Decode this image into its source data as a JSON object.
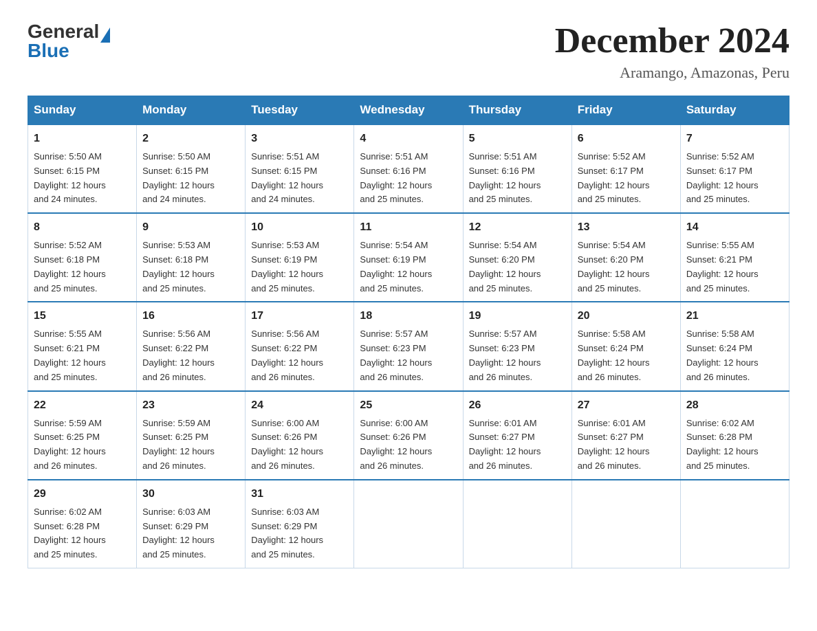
{
  "logo": {
    "general": "General",
    "triangle": "▶",
    "blue": "Blue"
  },
  "title": "December 2024",
  "subtitle": "Aramango, Amazonas, Peru",
  "days_of_week": [
    "Sunday",
    "Monday",
    "Tuesday",
    "Wednesday",
    "Thursday",
    "Friday",
    "Saturday"
  ],
  "weeks": [
    [
      {
        "day": "1",
        "sunrise": "5:50 AM",
        "sunset": "6:15 PM",
        "daylight": "12 hours and 24 minutes."
      },
      {
        "day": "2",
        "sunrise": "5:50 AM",
        "sunset": "6:15 PM",
        "daylight": "12 hours and 24 minutes."
      },
      {
        "day": "3",
        "sunrise": "5:51 AM",
        "sunset": "6:15 PM",
        "daylight": "12 hours and 24 minutes."
      },
      {
        "day": "4",
        "sunrise": "5:51 AM",
        "sunset": "6:16 PM",
        "daylight": "12 hours and 25 minutes."
      },
      {
        "day": "5",
        "sunrise": "5:51 AM",
        "sunset": "6:16 PM",
        "daylight": "12 hours and 25 minutes."
      },
      {
        "day": "6",
        "sunrise": "5:52 AM",
        "sunset": "6:17 PM",
        "daylight": "12 hours and 25 minutes."
      },
      {
        "day": "7",
        "sunrise": "5:52 AM",
        "sunset": "6:17 PM",
        "daylight": "12 hours and 25 minutes."
      }
    ],
    [
      {
        "day": "8",
        "sunrise": "5:52 AM",
        "sunset": "6:18 PM",
        "daylight": "12 hours and 25 minutes."
      },
      {
        "day": "9",
        "sunrise": "5:53 AM",
        "sunset": "6:18 PM",
        "daylight": "12 hours and 25 minutes."
      },
      {
        "day": "10",
        "sunrise": "5:53 AM",
        "sunset": "6:19 PM",
        "daylight": "12 hours and 25 minutes."
      },
      {
        "day": "11",
        "sunrise": "5:54 AM",
        "sunset": "6:19 PM",
        "daylight": "12 hours and 25 minutes."
      },
      {
        "day": "12",
        "sunrise": "5:54 AM",
        "sunset": "6:20 PM",
        "daylight": "12 hours and 25 minutes."
      },
      {
        "day": "13",
        "sunrise": "5:54 AM",
        "sunset": "6:20 PM",
        "daylight": "12 hours and 25 minutes."
      },
      {
        "day": "14",
        "sunrise": "5:55 AM",
        "sunset": "6:21 PM",
        "daylight": "12 hours and 25 minutes."
      }
    ],
    [
      {
        "day": "15",
        "sunrise": "5:55 AM",
        "sunset": "6:21 PM",
        "daylight": "12 hours and 25 minutes."
      },
      {
        "day": "16",
        "sunrise": "5:56 AM",
        "sunset": "6:22 PM",
        "daylight": "12 hours and 26 minutes."
      },
      {
        "day": "17",
        "sunrise": "5:56 AM",
        "sunset": "6:22 PM",
        "daylight": "12 hours and 26 minutes."
      },
      {
        "day": "18",
        "sunrise": "5:57 AM",
        "sunset": "6:23 PM",
        "daylight": "12 hours and 26 minutes."
      },
      {
        "day": "19",
        "sunrise": "5:57 AM",
        "sunset": "6:23 PM",
        "daylight": "12 hours and 26 minutes."
      },
      {
        "day": "20",
        "sunrise": "5:58 AM",
        "sunset": "6:24 PM",
        "daylight": "12 hours and 26 minutes."
      },
      {
        "day": "21",
        "sunrise": "5:58 AM",
        "sunset": "6:24 PM",
        "daylight": "12 hours and 26 minutes."
      }
    ],
    [
      {
        "day": "22",
        "sunrise": "5:59 AM",
        "sunset": "6:25 PM",
        "daylight": "12 hours and 26 minutes."
      },
      {
        "day": "23",
        "sunrise": "5:59 AM",
        "sunset": "6:25 PM",
        "daylight": "12 hours and 26 minutes."
      },
      {
        "day": "24",
        "sunrise": "6:00 AM",
        "sunset": "6:26 PM",
        "daylight": "12 hours and 26 minutes."
      },
      {
        "day": "25",
        "sunrise": "6:00 AM",
        "sunset": "6:26 PM",
        "daylight": "12 hours and 26 minutes."
      },
      {
        "day": "26",
        "sunrise": "6:01 AM",
        "sunset": "6:27 PM",
        "daylight": "12 hours and 26 minutes."
      },
      {
        "day": "27",
        "sunrise": "6:01 AM",
        "sunset": "6:27 PM",
        "daylight": "12 hours and 26 minutes."
      },
      {
        "day": "28",
        "sunrise": "6:02 AM",
        "sunset": "6:28 PM",
        "daylight": "12 hours and 25 minutes."
      }
    ],
    [
      {
        "day": "29",
        "sunrise": "6:02 AM",
        "sunset": "6:28 PM",
        "daylight": "12 hours and 25 minutes."
      },
      {
        "day": "30",
        "sunrise": "6:03 AM",
        "sunset": "6:29 PM",
        "daylight": "12 hours and 25 minutes."
      },
      {
        "day": "31",
        "sunrise": "6:03 AM",
        "sunset": "6:29 PM",
        "daylight": "12 hours and 25 minutes."
      },
      null,
      null,
      null,
      null
    ]
  ],
  "labels": {
    "sunrise": "Sunrise:",
    "sunset": "Sunset:",
    "daylight": "Daylight:"
  }
}
